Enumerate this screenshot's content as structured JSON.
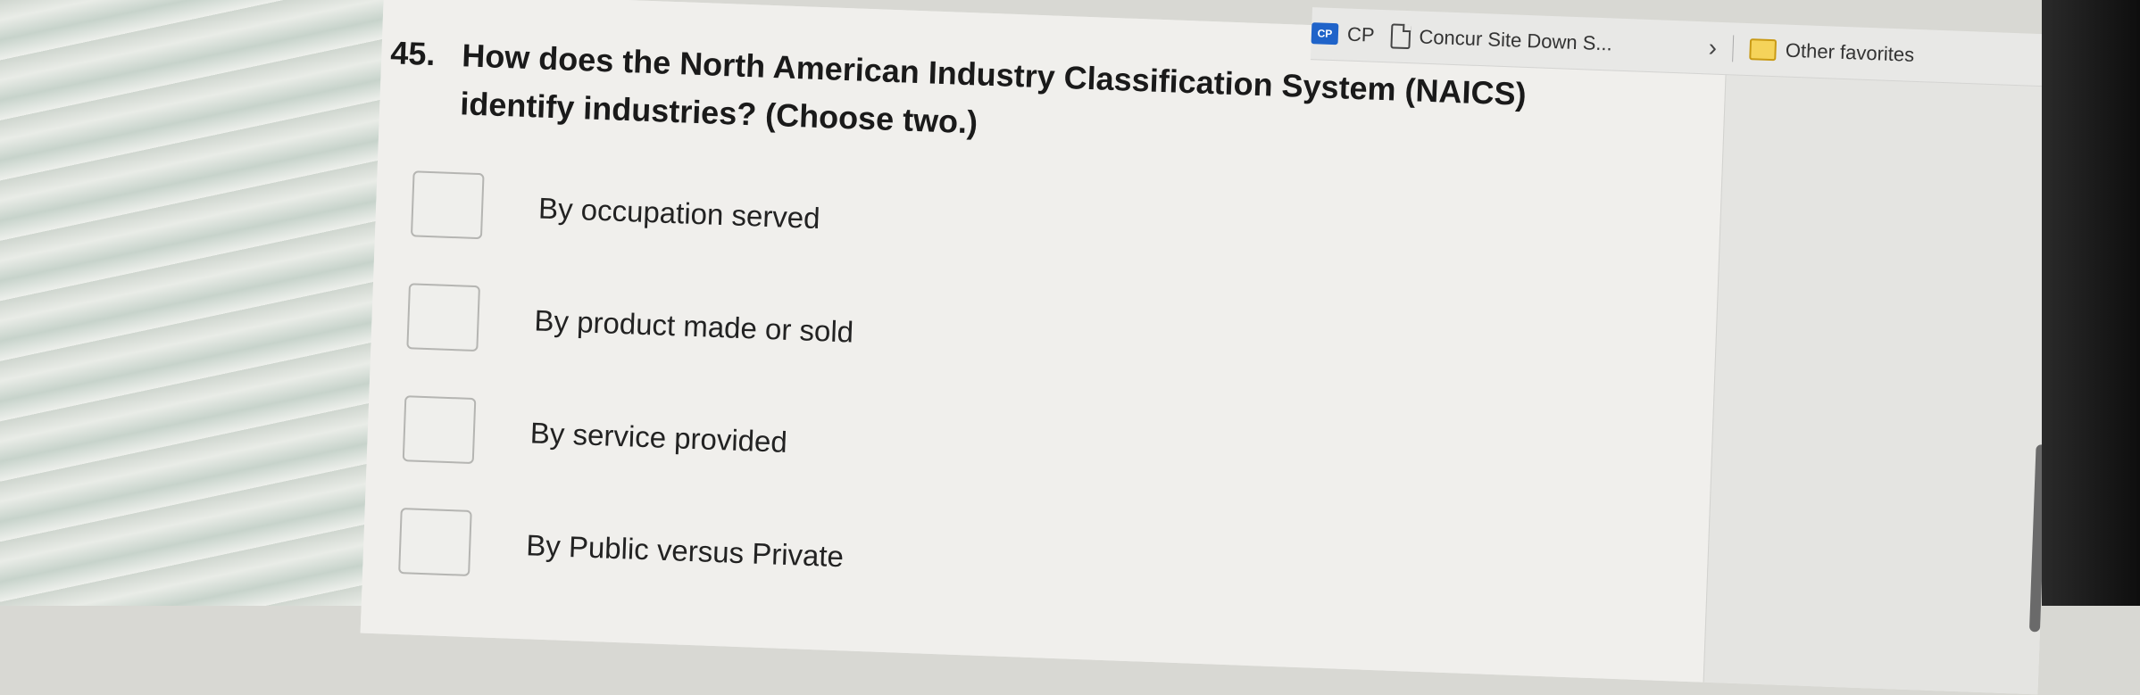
{
  "favorites_bar": {
    "items": [
      {
        "label": "CP",
        "icon": "cp-icon"
      },
      {
        "label": "Concur Site Down S...",
        "icon": "document-icon"
      }
    ],
    "other_favorites": "Other favorites"
  },
  "question": {
    "number": "45.",
    "text": "How does the North American Industry Classification System (NAICS) identify industries? (Choose two.)",
    "options": [
      {
        "label": "By occupation served",
        "checked": false
      },
      {
        "label": "By product made or sold",
        "checked": false
      },
      {
        "label": "By service provided",
        "checked": false
      },
      {
        "label": "By Public versus Private",
        "checked": false
      }
    ]
  },
  "colors": {
    "page_background": "#f0efec",
    "question_text": "#1a1a1a",
    "checkbox_border": "#b5b5b2"
  }
}
